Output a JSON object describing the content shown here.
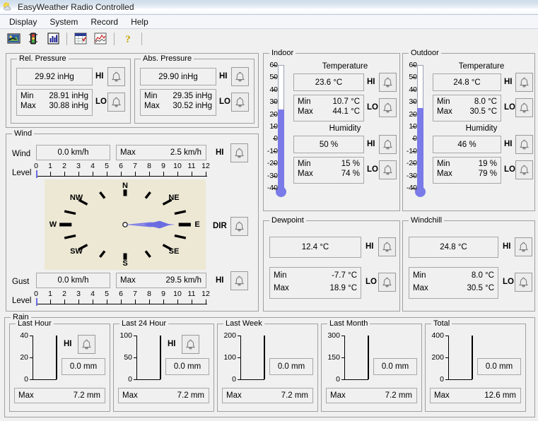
{
  "window": {
    "title": "EasyWeather Radio Controlled",
    "icon": "sun-cloud-icon"
  },
  "menu": {
    "items": [
      {
        "label": "Display"
      },
      {
        "label": "System"
      },
      {
        "label": "Record"
      },
      {
        "label": "Help"
      }
    ]
  },
  "toolbar": {
    "buttons": [
      {
        "name": "station-setup-icon",
        "title": "Station"
      },
      {
        "name": "traffic-light-icon",
        "title": "Alarm"
      },
      {
        "name": "bar-chart-icon",
        "title": "Histogram"
      },
      {
        "name": "calendar-table-icon",
        "title": "Records"
      },
      {
        "name": "line-graph-icon",
        "title": "Graph"
      },
      {
        "name": "help-question-icon",
        "title": "Help"
      }
    ]
  },
  "labels": {
    "hi": "HI",
    "lo": "LO",
    "dir": "DIR",
    "min": "Min",
    "max": "Max",
    "level": "Level",
    "temperature": "Temperature",
    "humidity": "Humidity"
  },
  "rel_pressure": {
    "legend": "Rel. Pressure",
    "current": "29.92 inHg",
    "min": "28.91 inHg",
    "max": "30.88 inHg"
  },
  "abs_pressure": {
    "legend": "Abs. Pressure",
    "current": "29.90 inHg",
    "min": "29.35 inHg",
    "max": "30.52 inHg"
  },
  "wind": {
    "legend": "Wind",
    "wind_label": "Wind",
    "wind_value": "0.0 km/h",
    "wind_max_label": "Max",
    "wind_max_value": "2.5 km/h",
    "gust_label": "Gust",
    "gust_value": "0.0 km/h",
    "gust_max_label": "Max",
    "gust_max_value": "29.5 km/h",
    "level_ticks": [
      "0",
      "1",
      "2",
      "3",
      "4",
      "5",
      "6",
      "7",
      "8",
      "9",
      "10",
      "11",
      "12"
    ],
    "compass": {
      "labels": [
        "N",
        "NE",
        "E",
        "SE",
        "S",
        "SW",
        "W",
        "NW"
      ],
      "direction": "E",
      "needle_angle_deg": 90
    }
  },
  "indoor": {
    "legend": "Indoor",
    "temp_current": "23.6 °C",
    "temp_min": "10.7 °C",
    "temp_max": "44.1 °C",
    "hum_current": "50 %",
    "hum_min": "15 %",
    "hum_max": "74 %",
    "thermo_scale": [
      "60",
      "50",
      "40",
      "30",
      "20",
      "10",
      "0",
      "-10",
      "-20",
      "-30",
      "-40"
    ],
    "thermo_value": 23.6
  },
  "outdoor": {
    "legend": "Outdoor",
    "temp_current": "24.8 °C",
    "temp_min": "8.0 °C",
    "temp_max": "30.5 °C",
    "hum_current": "46 %",
    "hum_min": "19 %",
    "hum_max": "79 %",
    "thermo_scale": [
      "60",
      "50",
      "40",
      "30",
      "20",
      "10",
      "0",
      "-10",
      "-20",
      "-30",
      "-40"
    ],
    "thermo_value": 24.8
  },
  "dewpoint": {
    "legend": "Dewpoint",
    "current": "12.4 °C",
    "min": "-7.7 °C",
    "max": "18.9 °C"
  },
  "windchill": {
    "legend": "Windchill",
    "current": "24.8 °C",
    "min": "8.0 °C",
    "max": "30.5 °C"
  },
  "rain": {
    "legend": "Rain",
    "panels": [
      {
        "legend": "Last Hour",
        "value": "0.0 mm",
        "max_label": "Max",
        "max_value": "7.2 mm",
        "y_ticks": [
          "40",
          "20",
          "0"
        ],
        "bar_pct": 0
      },
      {
        "legend": "Last 24 Hour",
        "value": "0.0 mm",
        "max_label": "Max",
        "max_value": "7.2 mm",
        "y_ticks": [
          "100",
          "50",
          "0"
        ],
        "bar_pct": 0
      },
      {
        "legend": "Last Week",
        "value": "0.0 mm",
        "max_label": "Max",
        "max_value": "7.2 mm",
        "y_ticks": [
          "200",
          "100",
          "0"
        ],
        "bar_pct": 0
      },
      {
        "legend": "Last Month",
        "value": "0.0 mm",
        "max_label": "Max",
        "max_value": "7.2 mm",
        "y_ticks": [
          "300",
          "150",
          "0"
        ],
        "bar_pct": 0
      },
      {
        "legend": "Total",
        "value": "0.0 mm",
        "max_label": "Max",
        "max_value": "12.6 mm",
        "y_ticks": [
          "400",
          "200",
          "0"
        ],
        "bar_pct": 0
      }
    ]
  },
  "colors": {
    "mercury": "#7a7ae8",
    "compass_bg": "#ece8d4",
    "needle": "#7b7be6",
    "face": "#f0f0f0"
  }
}
